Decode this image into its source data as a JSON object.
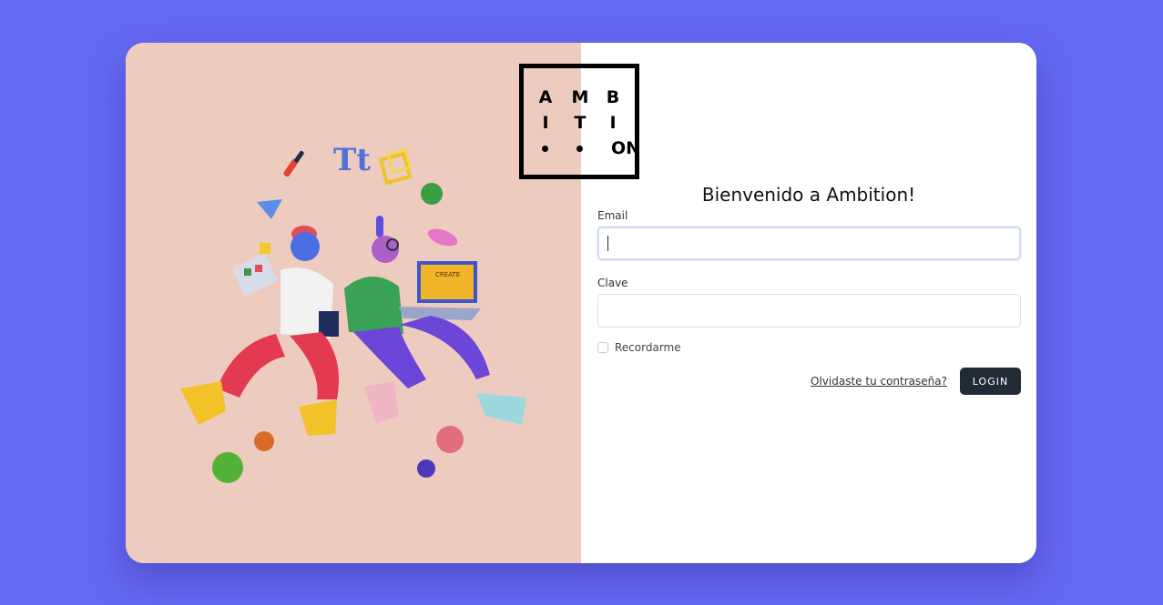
{
  "brand": {
    "logo_rows": [
      [
        "A",
        "M",
        "B"
      ],
      [
        "I",
        "T",
        "I"
      ],
      [
        "•",
        "•",
        "ON"
      ]
    ],
    "logo_text": "AMBITION"
  },
  "login": {
    "title": "Bienvenido a Ambition!",
    "email_label": "Email",
    "email_value": "",
    "password_label": "Clave",
    "password_value": "",
    "remember_label": "Recordarme",
    "remember_checked": false,
    "forgot_label": "Olvidaste tu contraseña?",
    "login_label": "LOGIN"
  },
  "illustration": {
    "description_icon": "people-juggling-illustration",
    "laptop_label": "CREATE"
  },
  "colors": {
    "page_background": "#6569f2",
    "left_panel": "#eecbbf",
    "button": "#212b36"
  }
}
